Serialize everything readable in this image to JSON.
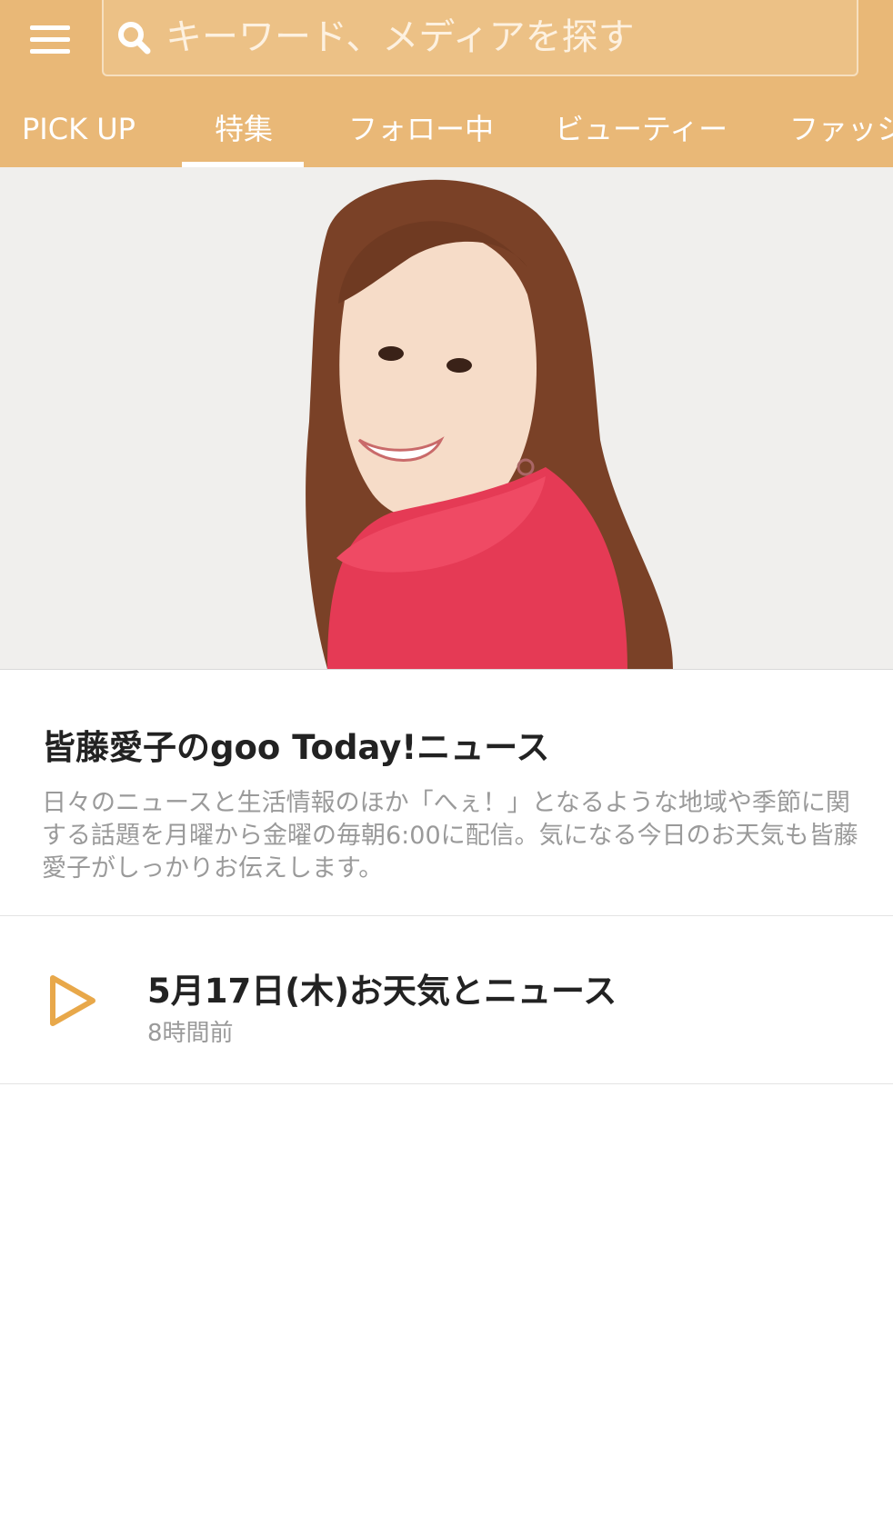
{
  "search": {
    "placeholder": "キーワード、メディアを探す"
  },
  "tabs": [
    {
      "label": "PICK UP"
    },
    {
      "label": "特集",
      "selected": true
    },
    {
      "label": "フォロー中"
    },
    {
      "label": "ビューティー"
    },
    {
      "label": "ファッシ"
    }
  ],
  "program": {
    "title": "皆藤愛子のgoo Today!ニュース",
    "description": "日々のニュースと生活情報のほか「へぇ！」となるような地域や季節に関する話題を月曜から金曜の毎朝6:00に配信。気になる今日のお天気も皆藤愛子がしっかりお伝えします。"
  },
  "episode": {
    "title": "5月17日(木)お天気とニュース",
    "time": "8時間前"
  },
  "icons": {
    "menu": "hamburger-menu-icon",
    "search": "search-icon",
    "play": "play-icon"
  },
  "colors": {
    "header_bg": "#e9b877",
    "accent": "#e8a84a",
    "title_text": "#222222",
    "secondary_text": "#9a9a9a"
  }
}
